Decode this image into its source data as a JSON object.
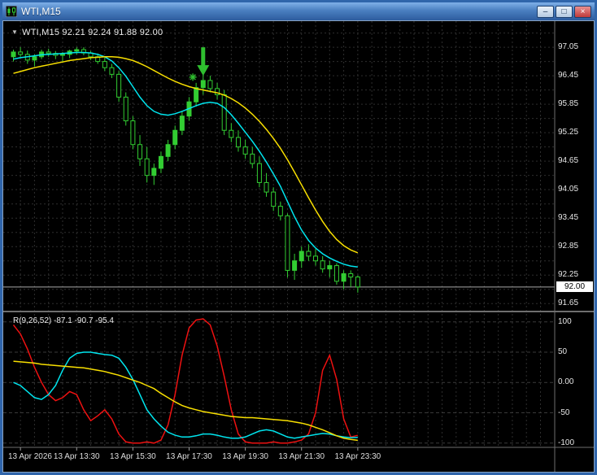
{
  "window": {
    "title": "WTI,M15",
    "controls": {
      "minimize": "–",
      "maximize": "□",
      "close": "×"
    }
  },
  "chart": {
    "dropdown_glyph": "▼",
    "symbol_label": "WTI,M15 92.21 92.24 91.88 92.00",
    "current_price": "92.00",
    "price_axis_labels": [
      "97.05",
      "96.45",
      "95.85",
      "95.25",
      "94.65",
      "94.05",
      "93.45",
      "92.85",
      "92.25",
      "91.65"
    ]
  },
  "indicator": {
    "label": "R(9,26,52) -87.1 -90.7 -95.4",
    "axis_labels": [
      "100",
      "50",
      "0.00",
      "-50",
      "-100"
    ],
    "levels": [
      100,
      50,
      0,
      -50,
      -100
    ]
  },
  "colors": {
    "background": "#000000",
    "grid": "#2e2e2e",
    "candle": "#32cd32",
    "ma_fast": "#00e5ee",
    "ma_slow": "#f8df00",
    "r_fast": "#ee1111",
    "r_mid": "#00e5ee",
    "r_slow": "#f8df00",
    "bid_line": "#a8a8a8",
    "marker": "#2fbf2f",
    "separator": "#6e6e6e",
    "axis_text": "#e6e6e6"
  },
  "chart_data": {
    "type": "candlestick",
    "symbol": "WTI",
    "timeframe": "M15",
    "title": "WTI,M15",
    "ohlc_readout": {
      "open": 92.21,
      "high": 92.24,
      "low": 91.88,
      "close": 92.0
    },
    "bid_price": 92.0,
    "price_axis_ticks": [
      97.05,
      96.45,
      95.85,
      95.25,
      94.65,
      94.05,
      93.45,
      92.85,
      92.25,
      91.65
    ],
    "candles": [
      [
        96.85,
        97.0,
        96.75,
        96.95
      ],
      [
        96.95,
        97.05,
        96.85,
        96.9
      ],
      [
        96.9,
        96.98,
        96.7,
        96.78
      ],
      [
        96.78,
        96.9,
        96.65,
        96.85
      ],
      [
        96.85,
        97.0,
        96.8,
        96.95
      ],
      [
        96.95,
        97.02,
        96.85,
        96.92
      ],
      [
        96.92,
        96.97,
        96.8,
        96.88
      ],
      [
        96.88,
        96.95,
        96.75,
        96.9
      ],
      [
        96.9,
        97.0,
        96.82,
        96.97
      ],
      [
        96.97,
        97.05,
        96.9,
        97.0
      ],
      [
        97.0,
        97.05,
        96.88,
        96.93
      ],
      [
        96.93,
        96.97,
        96.78,
        96.85
      ],
      [
        96.85,
        96.92,
        96.7,
        96.75
      ],
      [
        96.75,
        96.85,
        96.55,
        96.62
      ],
      [
        96.62,
        96.7,
        96.4,
        96.48
      ],
      [
        96.48,
        96.55,
        95.9,
        96.0
      ],
      [
        96.0,
        96.1,
        95.4,
        95.5
      ],
      [
        95.5,
        95.6,
        94.9,
        95.0
      ],
      [
        95.0,
        95.2,
        94.55,
        94.7
      ],
      [
        94.7,
        94.95,
        94.2,
        94.35
      ],
      [
        94.35,
        94.6,
        94.15,
        94.5
      ],
      [
        94.5,
        94.85,
        94.4,
        94.75
      ],
      [
        94.75,
        95.1,
        94.65,
        95.0
      ],
      [
        95.0,
        95.4,
        94.9,
        95.3
      ],
      [
        95.3,
        95.7,
        95.2,
        95.6
      ],
      [
        95.6,
        96.0,
        95.5,
        95.9
      ],
      [
        95.9,
        96.3,
        95.8,
        96.2
      ],
      [
        96.2,
        96.5,
        96.05,
        96.35
      ],
      [
        96.35,
        96.45,
        96.1,
        96.18
      ],
      [
        96.18,
        96.3,
        95.95,
        96.05
      ],
      [
        96.05,
        96.15,
        95.2,
        95.3
      ],
      [
        95.3,
        95.45,
        95.05,
        95.15
      ],
      [
        95.15,
        95.3,
        94.85,
        94.95
      ],
      [
        94.95,
        95.1,
        94.7,
        94.8
      ],
      [
        94.8,
        94.95,
        94.5,
        94.6
      ],
      [
        94.6,
        94.75,
        94.1,
        94.2
      ],
      [
        94.2,
        94.4,
        93.9,
        94.0
      ],
      [
        94.0,
        94.1,
        93.6,
        93.7
      ],
      [
        93.7,
        93.8,
        93.4,
        93.5
      ],
      [
        93.5,
        93.55,
        92.2,
        92.35
      ],
      [
        92.35,
        92.7,
        92.15,
        92.55
      ],
      [
        92.55,
        92.85,
        92.4,
        92.75
      ],
      [
        92.75,
        92.9,
        92.55,
        92.65
      ],
      [
        92.65,
        92.8,
        92.45,
        92.55
      ],
      [
        92.55,
        92.65,
        92.3,
        92.38
      ],
      [
        92.38,
        92.55,
        92.2,
        92.45
      ],
      [
        92.45,
        92.5,
        92.05,
        92.12
      ],
      [
        92.12,
        92.35,
        91.95,
        92.28
      ],
      [
        92.28,
        92.35,
        92.0,
        92.21
      ],
      [
        92.21,
        92.24,
        91.88,
        92.0
      ]
    ],
    "overlays": [
      {
        "name": "ma-fast",
        "color_key": "ma_fast",
        "values": [
          96.8,
          96.83,
          96.85,
          96.87,
          96.89,
          96.9,
          96.91,
          96.92,
          96.93,
          96.94,
          96.94,
          96.93,
          96.9,
          96.85,
          96.76,
          96.62,
          96.44,
          96.22,
          96.0,
          95.82,
          95.7,
          95.64,
          95.62,
          95.65,
          95.7,
          95.76,
          95.82,
          95.87,
          95.89,
          95.87,
          95.78,
          95.63,
          95.45,
          95.26,
          95.07,
          94.86,
          94.63,
          94.38,
          94.12,
          93.8,
          93.48,
          93.2,
          92.98,
          92.82,
          92.7,
          92.61,
          92.54,
          92.48,
          92.44,
          92.42
        ]
      },
      {
        "name": "ma-slow",
        "color_key": "ma_slow",
        "values": [
          96.5,
          96.54,
          96.58,
          96.62,
          96.65,
          96.68,
          96.71,
          96.74,
          96.77,
          96.79,
          96.81,
          96.83,
          96.84,
          96.85,
          96.85,
          96.84,
          96.81,
          96.77,
          96.71,
          96.64,
          96.56,
          96.48,
          96.4,
          96.33,
          96.27,
          96.22,
          96.18,
          96.15,
          96.12,
          96.09,
          96.04,
          95.97,
          95.88,
          95.77,
          95.64,
          95.49,
          95.32,
          95.13,
          94.92,
          94.68,
          94.42,
          94.15,
          93.88,
          93.62,
          93.38,
          93.17,
          93.0,
          92.87,
          92.78,
          92.72
        ]
      }
    ],
    "markers": [
      {
        "type": "arrow-down",
        "index": 27,
        "price_top": 97.05,
        "price_tip": 96.45
      },
      {
        "type": "star",
        "index": 26,
        "price": 96.42
      }
    ],
    "oscillator": {
      "name": "R(9,26,52)",
      "values_readout": [
        -87.1,
        -90.7,
        -95.4
      ],
      "range": [
        -107,
        113
      ],
      "levels": [
        100,
        50,
        0,
        -50,
        -100
      ],
      "series": [
        {
          "name": "r-fast",
          "color_key": "r_fast",
          "values": [
            95,
            80,
            55,
            25,
            0,
            -20,
            -30,
            -25,
            -15,
            -20,
            -45,
            -63,
            -55,
            -45,
            -60,
            -85,
            -98,
            -100,
            -100,
            -98,
            -100,
            -95,
            -70,
            -20,
            45,
            90,
            103,
            105,
            95,
            60,
            10,
            -45,
            -85,
            -98,
            -100,
            -100,
            -100,
            -98,
            -100,
            -100,
            -98,
            -95,
            -85,
            -50,
            20,
            45,
            5,
            -60,
            -90,
            -87.1
          ]
        },
        {
          "name": "r-mid",
          "color_key": "r_mid",
          "values": [
            0,
            -5,
            -15,
            -25,
            -28,
            -20,
            -5,
            20,
            40,
            48,
            50,
            50,
            48,
            46,
            45,
            40,
            25,
            5,
            -20,
            -45,
            -60,
            -72,
            -82,
            -87,
            -90,
            -90,
            -88,
            -85,
            -85,
            -87,
            -90,
            -92,
            -92,
            -90,
            -85,
            -80,
            -78,
            -80,
            -85,
            -90,
            -92,
            -90,
            -88,
            -86,
            -84,
            -85,
            -88,
            -90,
            -91,
            -90.7
          ]
        },
        {
          "name": "r-slow",
          "color_key": "r_slow",
          "values": [
            35,
            34,
            33,
            32,
            30,
            29,
            28,
            27,
            26,
            25,
            24,
            22,
            20,
            18,
            15,
            12,
            8,
            4,
            0,
            -5,
            -10,
            -18,
            -25,
            -32,
            -38,
            -42,
            -45,
            -48,
            -50,
            -52,
            -54,
            -56,
            -57,
            -58,
            -58,
            -59,
            -60,
            -61,
            -62,
            -63,
            -65,
            -67,
            -70,
            -74,
            -78,
            -83,
            -88,
            -92,
            -94,
            -95.4
          ]
        }
      ]
    },
    "time_ticks": [
      {
        "label": "13 Apr 2026",
        "index": 1,
        "align": "left"
      },
      {
        "label": "13 Apr 13:30",
        "index": 9
      },
      {
        "label": "13 Apr 15:30",
        "index": 17
      },
      {
        "label": "13 Apr 17:30",
        "index": 25
      },
      {
        "label": "13 Apr 19:30",
        "index": 33
      },
      {
        "label": "13 Apr 21:30",
        "index": 41
      },
      {
        "label": "13 Apr 23:30",
        "index": 49
      }
    ]
  }
}
